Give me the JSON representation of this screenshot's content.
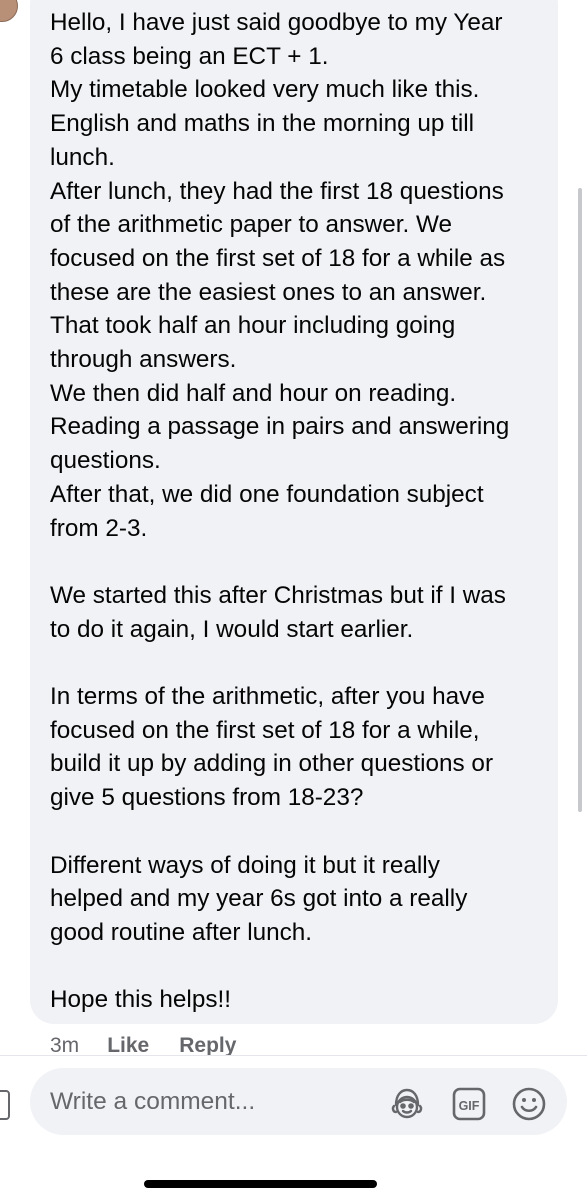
{
  "comment": {
    "lines": [
      "Hello, I have just said goodbye to my Year",
      "6 class being an ECT + 1.",
      "My timetable looked very much like this.",
      "English and maths in the morning up till",
      "lunch.",
      "After lunch, they had the first 18 questions",
      "of the arithmetic paper to answer. We",
      "focused on the first set of 18 for a while as",
      "these are the easiest ones to an answer.",
      "That took half an hour including going",
      "through answers.",
      "We then did half and hour on reading.",
      "Reading a passage in pairs and answering",
      "questions.",
      "After that, we did one foundation subject",
      "from 2-3.",
      "We started this after Christmas but if I was",
      "to do it again, I would start earlier.",
      "In terms of the arithmetic, after you have",
      "focused on the first set of 18 for a while,",
      "build it up by adding in other questions or",
      "give 5 questions from 18-23?",
      "Different ways of doing it but it really",
      "helped and my year 6s got into a really",
      "good routine after lunch.",
      "Hope this helps!!"
    ]
  },
  "actions": {
    "time": "3m",
    "like_label": "Like",
    "reply_label": "Reply"
  },
  "composer": {
    "placeholder": "Write a comment...",
    "icons": [
      "avatar-sticker-icon",
      "gif-icon",
      "emoji-icon"
    ]
  },
  "colors": {
    "bubble": "#f0f2f5",
    "secondary_text": "#65676b",
    "text": "#050505"
  }
}
